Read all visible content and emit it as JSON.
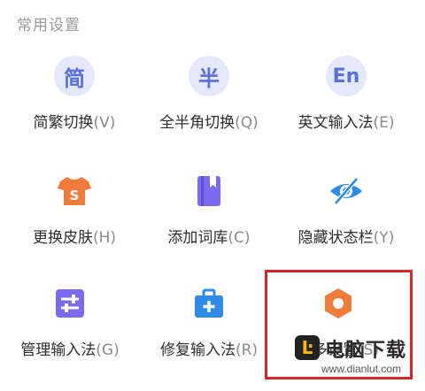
{
  "section_title": "常用设置",
  "colors": {
    "highlight": "#d6252a",
    "icon_circle_bg": "#e4e8fb",
    "icon_circle_fg": "#5a6fd8",
    "orange": "#f07c3c",
    "purple": "#7a6cf0",
    "blue": "#2f8be6"
  },
  "tiles": [
    {
      "icon": "simplified-traditional-icon",
      "icon_text": "简",
      "label": "简繁切换",
      "key": "(V)"
    },
    {
      "icon": "half-full-width-icon",
      "icon_text": "半",
      "label": "全半角切换",
      "key": "(Q)"
    },
    {
      "icon": "english-input-icon",
      "icon_text": "En",
      "label": "英文输入法",
      "key": "(E)"
    },
    {
      "icon": "tshirt-skin-icon",
      "label": "更换皮肤",
      "key": "(H)"
    },
    {
      "icon": "book-lexicon-icon",
      "label": "添加词库",
      "key": "(C)"
    },
    {
      "icon": "eye-hidden-icon",
      "label": "隐藏状态栏",
      "key": "(Y)"
    },
    {
      "icon": "sliders-manage-icon",
      "label": "管理输入法",
      "key": "(G)"
    },
    {
      "icon": "toolbox-repair-icon",
      "label": "修复输入法",
      "key": "(R)"
    },
    {
      "icon": "hexagon-settings-icon",
      "label": "更多设置",
      "key": "(S)"
    }
  ],
  "watermark": {
    "logo": "Ŀ",
    "name": "电脑下载",
    "url": "www.dianlut.com"
  }
}
